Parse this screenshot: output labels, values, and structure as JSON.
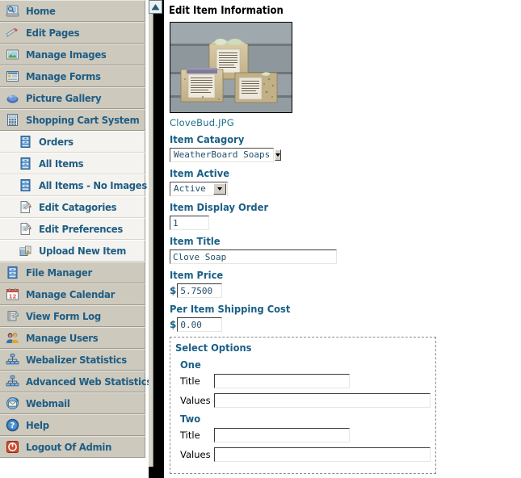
{
  "sidebar": {
    "items": [
      {
        "label": "Home",
        "icon": "monitor-icon",
        "level": "top"
      },
      {
        "label": "Edit Pages",
        "icon": "pencil-icon",
        "level": "top"
      },
      {
        "label": "Manage Images",
        "icon": "picture-icon",
        "level": "top"
      },
      {
        "label": "Manage Forms",
        "icon": "form-grid-icon",
        "level": "top"
      },
      {
        "label": "Picture Gallery",
        "icon": "gallery-icon",
        "level": "top"
      },
      {
        "label": "Shopping Cart System",
        "icon": "calculator-icon",
        "level": "top"
      },
      {
        "label": "Orders",
        "icon": "cabinet-icon",
        "level": "sub"
      },
      {
        "label": "All Items",
        "icon": "cabinet-icon",
        "level": "sub"
      },
      {
        "label": "All Items - No Images",
        "icon": "cabinet-icon",
        "level": "sub"
      },
      {
        "label": "Edit Catagories",
        "icon": "page-edit-icon",
        "level": "sub"
      },
      {
        "label": "Edit Preferences",
        "icon": "page-edit-icon",
        "level": "sub"
      },
      {
        "label": "Upload New Item",
        "icon": "upload-icon",
        "level": "sub"
      },
      {
        "label": "File Manager",
        "icon": "cabinet-icon",
        "level": "top"
      },
      {
        "label": "Manage Calendar",
        "icon": "calendar-icon",
        "level": "top"
      },
      {
        "label": "View Form Log",
        "icon": "notebook-icon",
        "level": "top"
      },
      {
        "label": "Manage Users",
        "icon": "users-icon",
        "level": "top"
      },
      {
        "label": "Webalizer Statistics",
        "icon": "network-icon",
        "level": "top"
      },
      {
        "label": "Advanced Web Statistics",
        "icon": "network-icon",
        "level": "top"
      },
      {
        "label": "Webmail",
        "icon": "mail-icon",
        "level": "top"
      },
      {
        "label": "Help",
        "icon": "help-icon",
        "level": "top"
      },
      {
        "label": "Logout Of Admin",
        "icon": "power-icon",
        "level": "top"
      }
    ]
  },
  "scrollbar": {
    "up_arrow_icon": "scroll-up-icon"
  },
  "main": {
    "page_title": "Edit Item Information",
    "thumbnail": {
      "alt": "Three handmade soap bars with paper labels on weathered wood",
      "filename_link": "CloveBud.JPG"
    },
    "fields": {
      "category": {
        "label": "Item Catagory",
        "value": "WeatherBoard Soaps"
      },
      "active": {
        "label": "Item Active",
        "value": "Active"
      },
      "display_order": {
        "label": "Item Display Order",
        "value": "1"
      },
      "title": {
        "label": "Item Title",
        "value": "Clove Soap"
      },
      "price": {
        "label": "Item Price",
        "currency": "$",
        "value": "5.7500"
      },
      "shipping": {
        "label": "Per Item Shipping Cost",
        "currency": "$",
        "value": "0.00"
      }
    },
    "options_panel": {
      "title": "Select Options",
      "groups": [
        {
          "name": "One",
          "title_label": "Title",
          "title_value": "",
          "values_label": "Values",
          "values_value": ""
        },
        {
          "name": "Two",
          "title_label": "Title",
          "title_value": "",
          "values_label": "Values",
          "values_value": ""
        }
      ]
    }
  },
  "colors": {
    "sidebar_top_bg": "#cdc9bd",
    "sidebar_sub_bg": "#f4f3ef",
    "link_blue": "#1f5d84",
    "label_blue": "#1a5f86",
    "scroll_track": "#000000"
  }
}
